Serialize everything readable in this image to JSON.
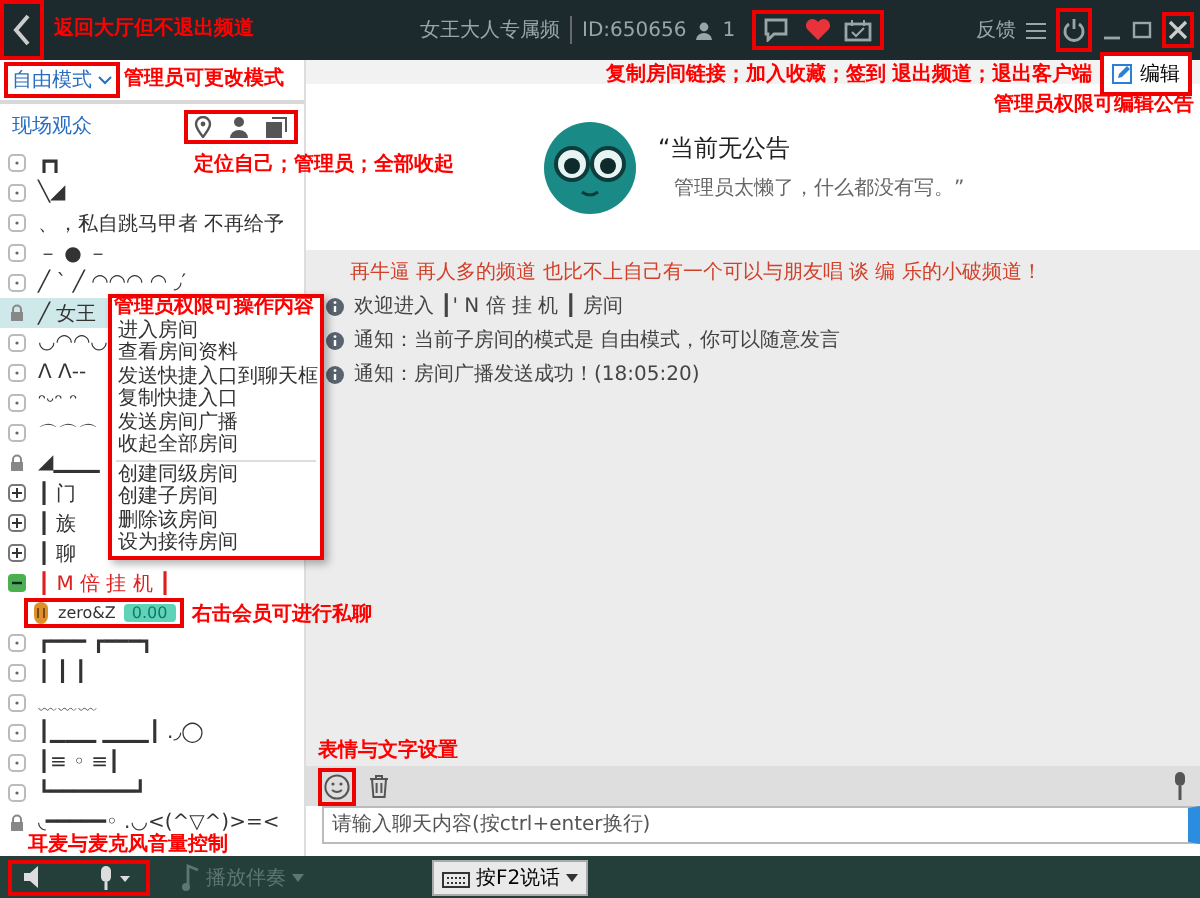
{
  "title_bar": {
    "back_button": {
      "highlighted": true,
      "annotation": "返回大厅但不退出频道"
    },
    "channel_name": "女王大人专属频",
    "channel_id": "ID:650656",
    "online_count": "1",
    "actions": {
      "highlighted": true,
      "annotation": "复制房间链接；加入收藏；签到"
    },
    "feedback": "反馈",
    "power_button": {
      "highlighted": true
    },
    "close_button": {
      "highlighted": true
    },
    "exit_annotation": "退出频道；退出客户端"
  },
  "sidebar": {
    "mode_dropdown": {
      "label": "自由模式",
      "highlighted": true,
      "annotation": "管理员可更改模式"
    },
    "audience_label": "现场观众",
    "tools": {
      "highlighted": true,
      "annotation": "定位自己；管理员；全部收起"
    },
    "tree": [
      {
        "kind": "dot",
        "label": "┏┓",
        "selected": false
      },
      {
        "kind": "dot",
        "label": "╲◢",
        "selected": false
      },
      {
        "kind": "dot",
        "label": "、，私自跳马甲者 不再给予",
        "selected": false
      },
      {
        "kind": "dot",
        "label": "－ ● －",
        "selected": false
      },
      {
        "kind": "dot",
        "label": "╱ ˋ ╱ ◠◠◠ ◠ ◞′",
        "selected": false
      },
      {
        "kind": "lock",
        "label": "╱ 女王",
        "selected": true
      },
      {
        "kind": "dot",
        "label": "◡◠◠◡",
        "selected": false
      },
      {
        "kind": "dot",
        "label": "ᐱ ᐱ--",
        "selected": false
      },
      {
        "kind": "dot",
        "label": "ᵔᵕᵔ ᵔ",
        "selected": false
      },
      {
        "kind": "dot",
        "label": "⌒⌒⌒",
        "selected": false
      },
      {
        "kind": "lock",
        "label": "◢▁▁▁",
        "selected": false
      },
      {
        "kind": "collapsed",
        "label": "┃ 门",
        "selected": false
      },
      {
        "kind": "collapsed",
        "label": "┃ 族",
        "selected": false
      },
      {
        "kind": "collapsed",
        "label": "┃ 聊",
        "selected": false
      },
      {
        "kind": "expanded",
        "label": "┃ M 倍 挂 机 ┃",
        "selected": false,
        "color": "#e02020",
        "children": [
          {
            "name": "zero&Z",
            "badge": "0.00",
            "highlighted": true,
            "annotation": "右击会员可进行私聊"
          }
        ]
      },
      {
        "kind": "dot",
        "label": "┏━━━ ┏━━━┓",
        "selected": false
      },
      {
        "kind": "dot",
        "label": "┃  ┃    ┃",
        "selected": false
      },
      {
        "kind": "dot",
        "label": "﹏﹏﹏",
        "selected": false
      },
      {
        "kind": "dot",
        "label": "┃▁▁▁ ▁▁▁┃ .◞◯",
        "selected": false
      },
      {
        "kind": "dot",
        "label": "┃≡  ◦  ≡┃",
        "selected": false
      },
      {
        "kind": "dot",
        "label": "┗━━━━━━━┛",
        "selected": false
      },
      {
        "kind": "lock",
        "label": "◟━━━━━◦ .◡<(^▽^)>=<",
        "selected": false
      }
    ]
  },
  "announcement": {
    "edit_button": {
      "label": "编辑",
      "highlighted": true,
      "annotation": "管理员权限可编辑公告"
    },
    "title": "“当前无公告",
    "body": "管理员太懒了，什么都没有写。”"
  },
  "messages": [
    {
      "kind": "banner",
      "text": "再牛逼 再人多的频道 也比不上自己有一个可以与朋友唱 谈 编 乐的小破频道！"
    },
    {
      "kind": "info",
      "text": "欢迎进入 ┃' N  倍  挂 机 ┃ 房间"
    },
    {
      "kind": "info",
      "text": "通知：当前子房间的模式是 自由模式，你可以随意发言"
    },
    {
      "kind": "info",
      "text": "通知：房间广播发送成功！(18:05:20)"
    }
  ],
  "composer": {
    "emoji_button": {
      "highlighted": true,
      "annotation": "表情与文字设置"
    },
    "placeholder": "请输入聊天内容(按ctrl+enter换行)"
  },
  "bottom_bar": {
    "audio_controls": {
      "highlighted": true,
      "annotation": "耳麦与麦克风音量控制"
    },
    "accompaniment": "播放伴奏",
    "talk_button": "按F2说话"
  },
  "context_menu": {
    "highlighted": true,
    "annotation": "管理员权限可操作内容",
    "groups": [
      [
        "进入房间",
        "查看房间资料",
        "发送快捷入口到聊天框",
        "复制快捷入口",
        "发送房间广播",
        "收起全部房间"
      ],
      [
        "创建同级房间",
        "创建子房间",
        "删除该房间",
        "设为接待房间"
      ]
    ]
  }
}
